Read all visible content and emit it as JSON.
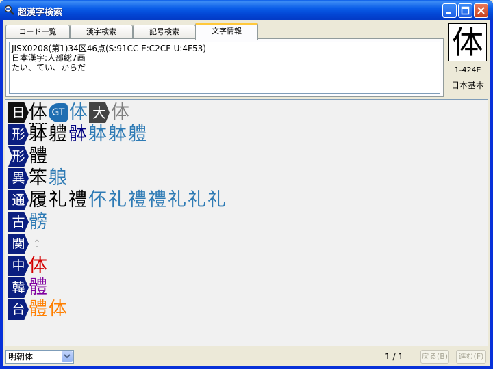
{
  "window": {
    "title": "超漢字検索"
  },
  "tabs": [
    "コード一覧",
    "漢字検索",
    "記号検索",
    "文字情報"
  ],
  "info": {
    "line1": "JISX0208(第1)34区46点(S:91CC  E:C2CE  U:4F53)",
    "line2": "日本漢字:人部総7画",
    "line3": "たい、てい、からだ"
  },
  "preview": {
    "char": "体",
    "code": "1-424E",
    "category": "日本基本"
  },
  "rows": [
    {
      "label": "日",
      "black": true,
      "chars": [
        {
          "c": "体",
          "color": "#000000",
          "selected": true
        }
      ],
      "gt": "GT",
      "gt_chars": [
        {
          "c": "体",
          "color": "#2E7BB5"
        }
      ],
      "dai": "大",
      "dai_chars": [
        {
          "c": "体",
          "color": "#808080"
        }
      ]
    },
    {
      "label": "形",
      "chars": [
        {
          "c": "躰",
          "color": "#000000"
        },
        {
          "c": "軆",
          "color": "#000000"
        },
        {
          "c": "骵",
          "color": "#000080"
        },
        {
          "c": "躰",
          "color": "#2E7BB5"
        },
        {
          "c": "躰",
          "color": "#2E7BB5"
        },
        {
          "c": "軆",
          "color": "#2E7BB5"
        }
      ]
    },
    {
      "label": "形",
      "notch": true,
      "chars": [
        {
          "c": "體",
          "color": "#000000"
        }
      ]
    },
    {
      "label": "異",
      "chars": [
        {
          "c": "笨",
          "color": "#000000"
        },
        {
          "c": "躴",
          "color": "#2E7BB5"
        }
      ]
    },
    {
      "label": "通",
      "chars": [
        {
          "c": "履",
          "color": "#000000"
        },
        {
          "c": "礼",
          "color": "#000000"
        },
        {
          "c": "禮",
          "color": "#000000"
        },
        {
          "c": "伓",
          "color": "#2E7BB5"
        },
        {
          "c": "礼",
          "color": "#2E7BB5"
        },
        {
          "c": "禮",
          "color": "#2E7BB5"
        },
        {
          "c": "禮",
          "color": "#2E7BB5"
        },
        {
          "c": "礼",
          "color": "#2E7BB5"
        },
        {
          "c": "礼",
          "color": "#2E7BB5"
        },
        {
          "c": "礼",
          "color": "#2E7BB5"
        }
      ]
    },
    {
      "label": "古",
      "chars": [
        {
          "c": "髈",
          "color": "#2E7BB5"
        }
      ]
    },
    {
      "label": "関",
      "chars": [
        {
          "c": "⇧",
          "color": "#999999",
          "small": true
        }
      ]
    },
    {
      "label": "中",
      "chars": [
        {
          "c": "体",
          "color": "#D40000"
        }
      ]
    },
    {
      "label": "韓",
      "chars": [
        {
          "c": "體",
          "color": "#8000A0"
        }
      ]
    },
    {
      "label": "台",
      "chars": [
        {
          "c": "體",
          "color": "#FF7F00"
        },
        {
          "c": "体",
          "color": "#FF7F00"
        }
      ]
    }
  ],
  "status": {
    "font": "明朝体",
    "page": "1 / 1",
    "back": "戻る(B)",
    "forward": "進む(F)"
  }
}
